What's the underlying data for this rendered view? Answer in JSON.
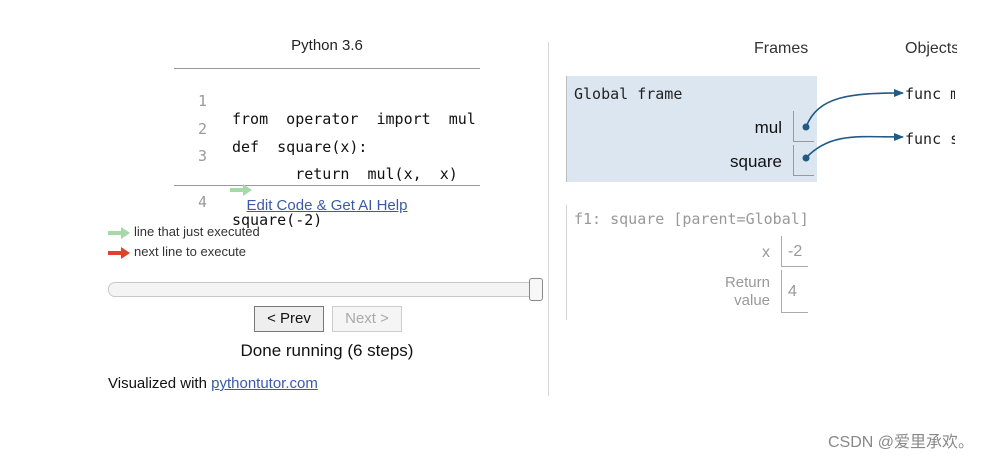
{
  "language": "Python 3.6",
  "code": {
    "lines": [
      {
        "num": "1",
        "text": "from  operator  import  mul"
      },
      {
        "num": "2",
        "text": "def  square(x):"
      },
      {
        "num": "3",
        "text": "       return  mul(x,  x)"
      },
      {
        "num": "4",
        "text": "square(-2)"
      }
    ]
  },
  "edit_link": "Edit Code & Get AI Help",
  "legend": {
    "just_executed": "line that just executed",
    "next_to_execute": "next line to execute",
    "just_executed_color": "#a6d8a8",
    "next_color": "#e0422f"
  },
  "controls": {
    "prev_label": "< Prev",
    "next_label": "Next >",
    "status": "Done running (6 steps)",
    "progress": 1.0
  },
  "footer": {
    "prefix": "Visualized with ",
    "link": "pythontutor.com"
  },
  "viz": {
    "frames_header": "Frames",
    "objects_header": "Objects",
    "global_frame": {
      "title": "Global frame",
      "vars": [
        {
          "name": "mul"
        },
        {
          "name": "square"
        }
      ]
    },
    "objects": [
      {
        "label": "func mul"
      },
      {
        "label": "func square"
      }
    ],
    "f1": {
      "title": "f1: square [parent=Global]",
      "x_name": "x",
      "x_value": "-2",
      "return_name": "Return value",
      "return_value": "4"
    },
    "arrow_color": "#1f5b85",
    "frame_color": "#dce6f0"
  },
  "watermark": "CSDN @爱里承欢。"
}
